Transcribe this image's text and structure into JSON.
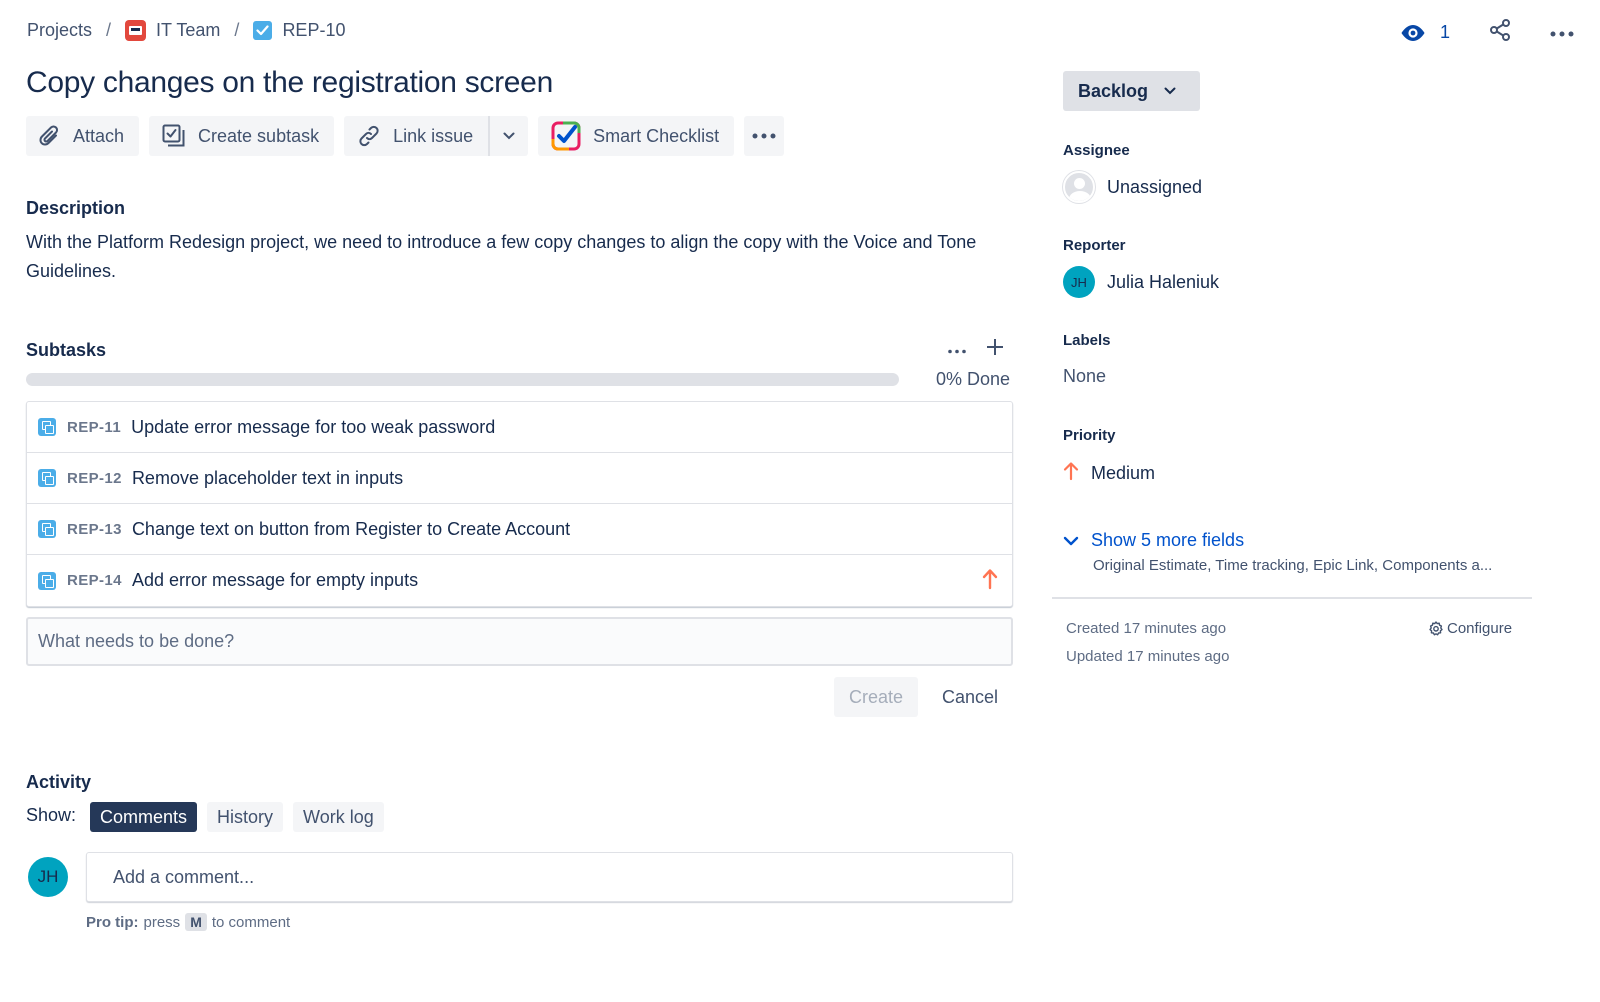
{
  "breadcrumb": {
    "projects": "Projects",
    "project": "IT Team",
    "issue_key": "REP-10"
  },
  "header": {
    "watch_count": "1"
  },
  "issue": {
    "title": "Copy changes on the registration screen"
  },
  "toolbar": {
    "attach": "Attach",
    "create_subtask": "Create subtask",
    "link_issue": "Link issue",
    "smart_checklist": "Smart Checklist"
  },
  "description": {
    "heading": "Description",
    "text": "With the Platform Redesign project, we need to introduce a few copy changes to align the copy with the Voice and Tone Guidelines."
  },
  "subtasks": {
    "heading": "Subtasks",
    "progress_percent": 0,
    "progress_label": "0% Done",
    "items": [
      {
        "key": "REP-11",
        "summary": "Update error message for too weak password",
        "priority": ""
      },
      {
        "key": "REP-12",
        "summary": "Remove placeholder text in inputs",
        "priority": ""
      },
      {
        "key": "REP-13",
        "summary": "Change text on button from Register to Create Account",
        "priority": ""
      },
      {
        "key": "REP-14",
        "summary": "Add error message for empty inputs",
        "priority": "arrow-up-icon"
      }
    ],
    "new_placeholder": "What needs to be done?",
    "create_label": "Create",
    "cancel_label": "Cancel"
  },
  "activity": {
    "heading": "Activity",
    "show_label": "Show:",
    "tabs": [
      "Comments",
      "History",
      "Work log"
    ],
    "active_tab": "Comments",
    "comment_avatar": "JH",
    "comment_placeholder": "Add a comment...",
    "protip_bold": "Pro tip:",
    "protip_pre": "press",
    "protip_key": "M",
    "protip_post": "to comment"
  },
  "sidebar": {
    "status": "Backlog",
    "assignee_label": "Assignee",
    "assignee_value": "Unassigned",
    "reporter_label": "Reporter",
    "reporter_initials": "JH",
    "reporter_value": "Julia Haleniuk",
    "labels_label": "Labels",
    "labels_value": "None",
    "priority_label": "Priority",
    "priority_value": "Medium",
    "show_more": "Show 5 more fields",
    "show_more_sub": "Original Estimate, Time tracking, Epic Link, Components a...",
    "created": "Created 17 minutes ago",
    "updated": "Updated 17 minutes ago",
    "configure": "Configure"
  },
  "colors": {
    "link": "#0052cc",
    "priority_medium": "#ff7452",
    "avatar_teal": "#00a3bf",
    "active_tab": "#253858"
  }
}
